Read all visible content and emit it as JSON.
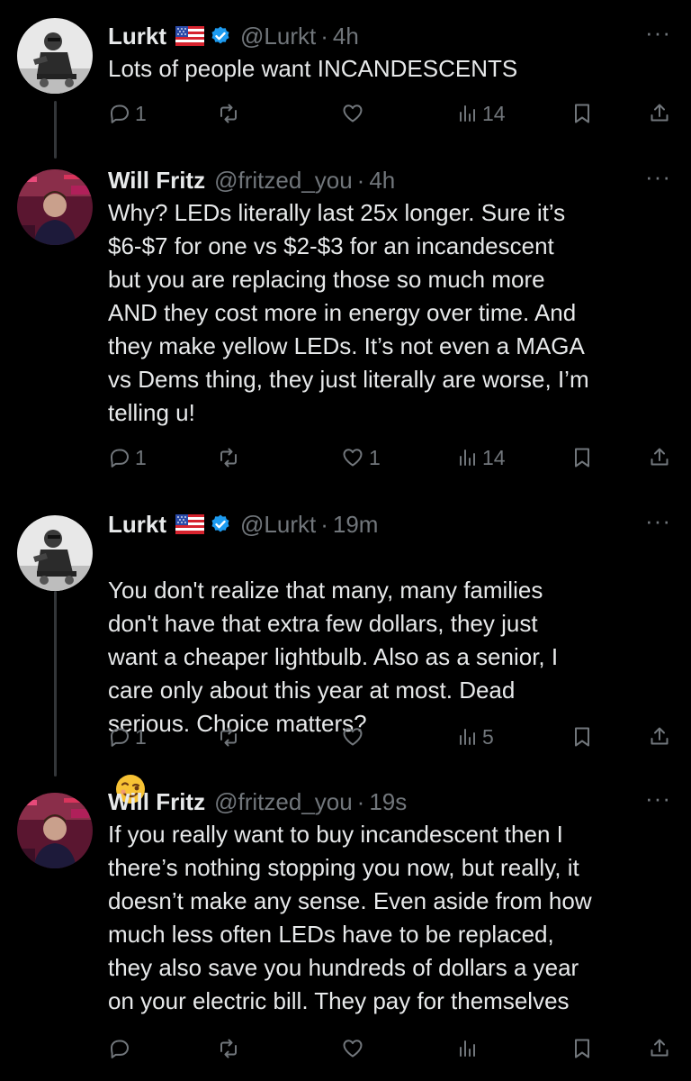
{
  "tweets": [
    {
      "name": "Lurkt",
      "handle": "@Lurkt",
      "sep": "·",
      "time": "4h",
      "verified": true,
      "flag": true,
      "more": "···",
      "text": "Lots of people want INCANDESCENTS",
      "replies": "1",
      "retweets": "",
      "likes": "",
      "views": "14"
    },
    {
      "name": "Will Fritz",
      "handle": "@fritzed_you",
      "sep": "·",
      "time": "4h",
      "verified": false,
      "flag": false,
      "more": "···",
      "text": "Why? LEDs literally last 25x longer. Sure it’s\n$6-$7 for one vs $2-$3 for an incandescent\nbut you are replacing those so much more\nAND they cost more in energy over time. And\nthey make yellow LEDs. It’s not even a MAGA\nvs Dems thing, they just literally are worse, I’m\ntelling u!",
      "replies": "1",
      "retweets": "",
      "likes": "1",
      "views": "14"
    },
    {
      "name": "Lurkt",
      "handle": "@Lurkt",
      "sep": "·",
      "time": "19m",
      "verified": true,
      "flag": true,
      "more": "···",
      "text": "You don't realize that many, many families\ndon't have that extra few dollars, they just\nwant a cheaper lightbulb. Also as a senior, I\ncare only about this year at most. Dead\nserious. Choice matters?",
      "emoji": "winking-face",
      "replies": "1",
      "retweets": "",
      "likes": "",
      "views": "5"
    },
    {
      "name": "Will Fritz",
      "handle": "@fritzed_you",
      "sep": "·",
      "time": "19s",
      "verified": false,
      "flag": false,
      "more": "···",
      "text": "If you really want to buy incandescent then I\nthere’s nothing stopping you now, but really, it\ndoesn’t make any sense. Even aside from how\nmuch less often LEDs have to be replaced,\nthey also save you hundreds of dollars a year\non your electric bill. They pay for themselves",
      "replies": "",
      "retweets": "",
      "likes": "",
      "views": ""
    }
  ],
  "colors": {
    "background": "#000000",
    "text": "#e7e9ea",
    "muted": "#71767b",
    "verified": "#1d9bf0",
    "thread_line": "#333639"
  },
  "icons": [
    "reply-icon",
    "retweet-icon",
    "like-icon",
    "views-icon",
    "bookmark-icon",
    "share-icon",
    "verified-badge-icon",
    "us-flag-icon",
    "more-icon"
  ]
}
